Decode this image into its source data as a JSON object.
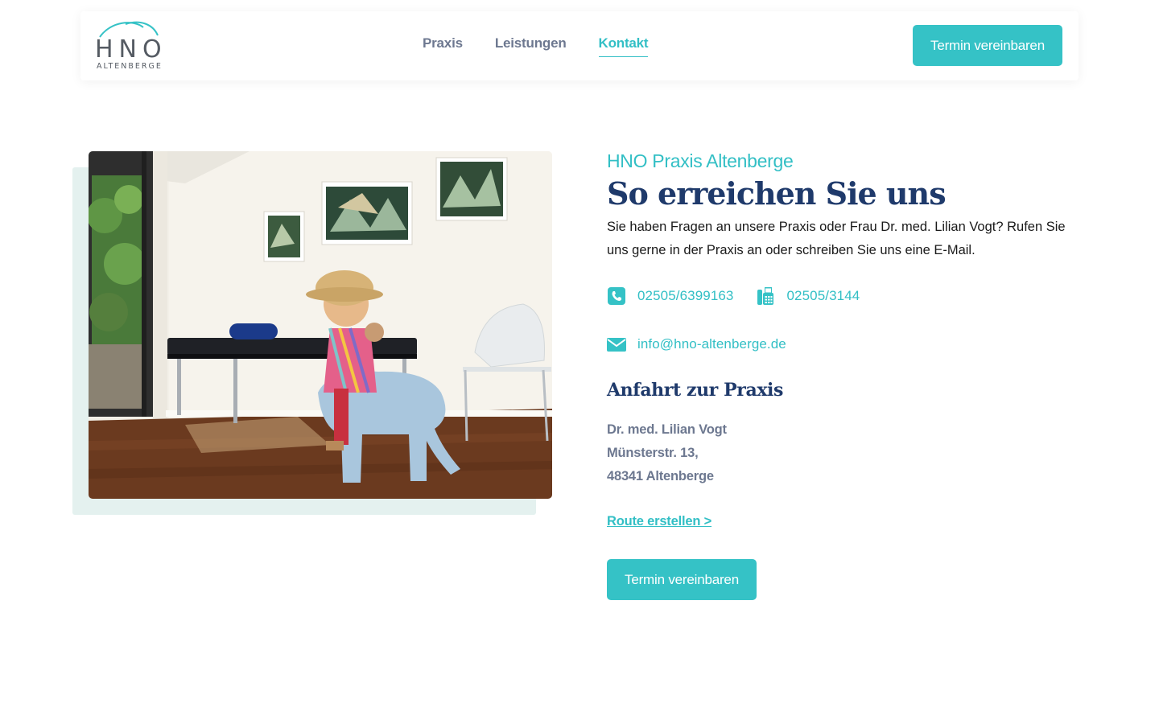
{
  "logo": {
    "main": "HNO",
    "sub": "ALTENBERGE"
  },
  "nav": {
    "items": [
      {
        "label": "Praxis"
      },
      {
        "label": "Leistungen"
      },
      {
        "label": "Kontakt"
      }
    ]
  },
  "header_cta": "Termin vereinbaren",
  "content": {
    "eyebrow": "HNO Praxis Altenberge",
    "title": "So erreichen Sie uns",
    "intro": "Sie haben Fragen an unsere Praxis oder Frau Dr. med. Lilian Vogt? Rufen Sie uns gerne in der Praxis an oder schreiben Sie uns eine E-Mail.",
    "phone": "02505/6399163",
    "fax": "02505/3144",
    "email": "info@hno-altenberge.de",
    "directions_title": "Anfahrt zur Praxis",
    "address": {
      "line1": "Dr. med. Lilian Vogt",
      "line2": "Münsterstr. 13,",
      "line3": "48341 Altenberge"
    },
    "route_link": "Route erstellen >",
    "cta": "Termin vereinbaren"
  },
  "colors": {
    "accent": "#35c2c6",
    "navy": "#1f3a6b",
    "muted": "#6d7890"
  },
  "icons": {
    "phone": "phone-icon",
    "fax": "fax-icon",
    "email": "envelope-icon"
  }
}
